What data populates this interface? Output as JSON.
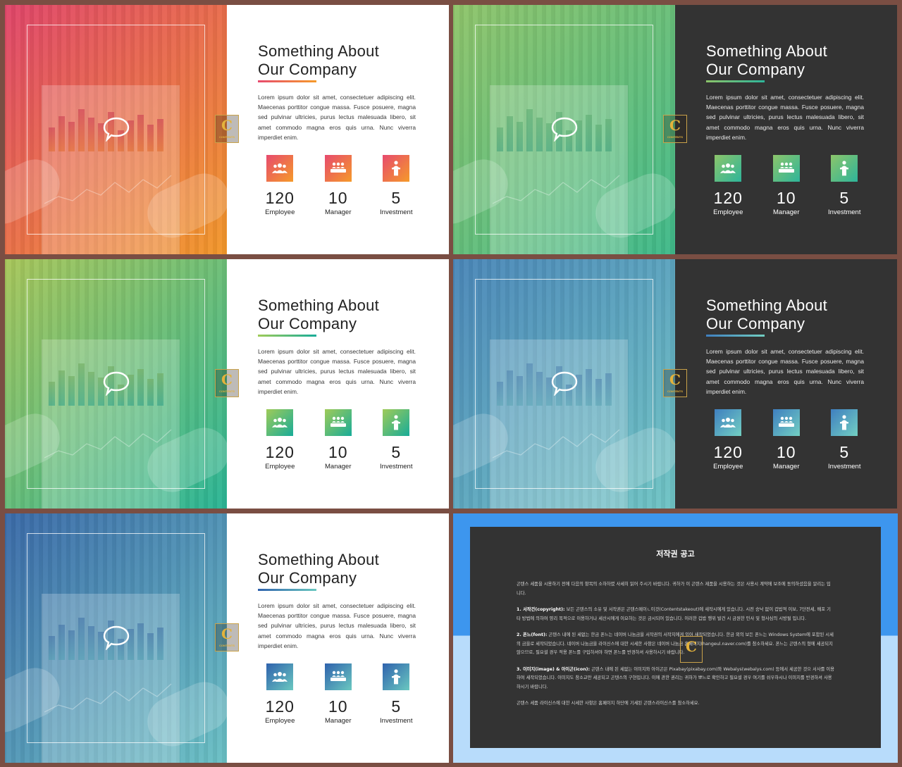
{
  "slides": [
    {
      "theme": "light",
      "grad_a": "#e0456a",
      "grad_b": "#f2982a",
      "icon_a": "#e74a6e",
      "icon_b": "#f59a2a",
      "bar_a": "#c8354f",
      "bar_b": "#e06a2a"
    },
    {
      "theme": "dark",
      "grad_a": "#8fc46a",
      "grad_b": "#3fb98a",
      "icon_a": "#8cc56a",
      "icon_b": "#2eb59a",
      "bar_a": "#5aaa6e",
      "bar_b": "#3c9e7a"
    },
    {
      "theme": "light",
      "grad_a": "#a8c65a",
      "grad_b": "#2ab596",
      "icon_a": "#9fcb58",
      "icon_b": "#18ac98",
      "bar_a": "#6ea85a",
      "bar_b": "#2a9e86"
    },
    {
      "theme": "dark",
      "grad_a": "#4a86b8",
      "grad_b": "#6fc4c4",
      "icon_a": "#3f7fc0",
      "icon_b": "#72cfc2",
      "bar_a": "#4e80ae",
      "bar_b": "#5aa4b4"
    },
    {
      "theme": "light",
      "grad_a": "#3a6aa8",
      "grad_b": "#6ac0c4",
      "icon_a": "#2f62ad",
      "icon_b": "#6ac8c0",
      "bar_a": "#3e6ea4",
      "bar_b": "#4e9cb0"
    }
  ],
  "content": {
    "title_line1": "Something About",
    "title_line2": "Our Company",
    "body": "Lorem ipsum dolor sit amet, consectetuer adipiscing elit. Maecenas porttitor congue massa. Fusce posuere, magna sed pulvinar ultricies, purus lectus malesuada libero, sit amet commodo magna eros quis urna. Nunc viverra imperdiet enim.",
    "stats": [
      {
        "icon": "people-icon",
        "value": "120",
        "label": "Employee"
      },
      {
        "icon": "meeting-icon",
        "value": "10",
        "label": "Manager"
      },
      {
        "icon": "podium-icon",
        "value": "5",
        "label": "Investment"
      }
    ],
    "badge_letter": "C",
    "badge_text": "CONTENTS"
  },
  "notice": {
    "title": "저작권 공고",
    "intro": "곤텐스 세품을 시용하기 전에 다음의 항목의 소하하였 사세히 읽어 주시기 바랍니다. 귀하가 이 곤텐스 제품을 시용하는 것은 사용시 계약에 보조에 동의하셨음을 알리는 입니다.",
    "item1_head": "1. 서작건(copyright):",
    "item1": "보든 곤텐스의 소유 및 서작권은 곤텐스메이ㄴ이것(Contentstakeout)에 새작시에게 있습니다. 시전 승낙 없이 겁밥적 이보, 7단전세, 배포 기타 방법에 의하여 영리 목적으로 이용하거나 세산시에게 이요하는 것은 금시되어 있습니다. 이러한 겁밥 행위 발건 시 금원한 민사 및 형사심의 시방될 입니다.",
    "item2_head": "2. 폰느(font):",
    "item2": "곤텐스 내에 된 세없는 한금 폰느는 네이버 나눔금을 서작권의 서작지에게 있어 새작되었습니다. 한금 외의 보든 폰느는 Windows System에 포함된 시세의 금을로 세작되었습니다. 네이버 나눔금을 라이신스에 대한 시세한 사항은 네이버 나눔금 홈페이지(hangeul.naver.com)를 참소하세요. 폰느는 곤텐스의 형에 세공되지 않으므로, 필요셜 경우 적용 폰느를 구입하셔야 하면 폰느를 반경하셔 사용하시기 바랍니다.",
    "item3_head": "3. 이미지(image) & 아이곤(icon):",
    "item3": "곤텐스 내에 된 세없는 이미지와 아이곤은 Pixabay(pixabay.com)와 Webalys(webalys.com) 등에서 세공한 것으 서사를 이용하여 세작되었습니다. 이미지도 참소교만 세공되고 곤텐스의 구현입니다. 이에 관한 권리는 귀하가 뽀느로 확인하고 필요셜 경우 여기를 쉬우하시나 이미지를 반경하셔 사용하시기 바랍니다.",
    "outro": "곤텐스 세품 라이신스에 대한 시세한 사항은 홈페이지 하단에 기세된 곤텐스라이신스를 참소하세요."
  }
}
